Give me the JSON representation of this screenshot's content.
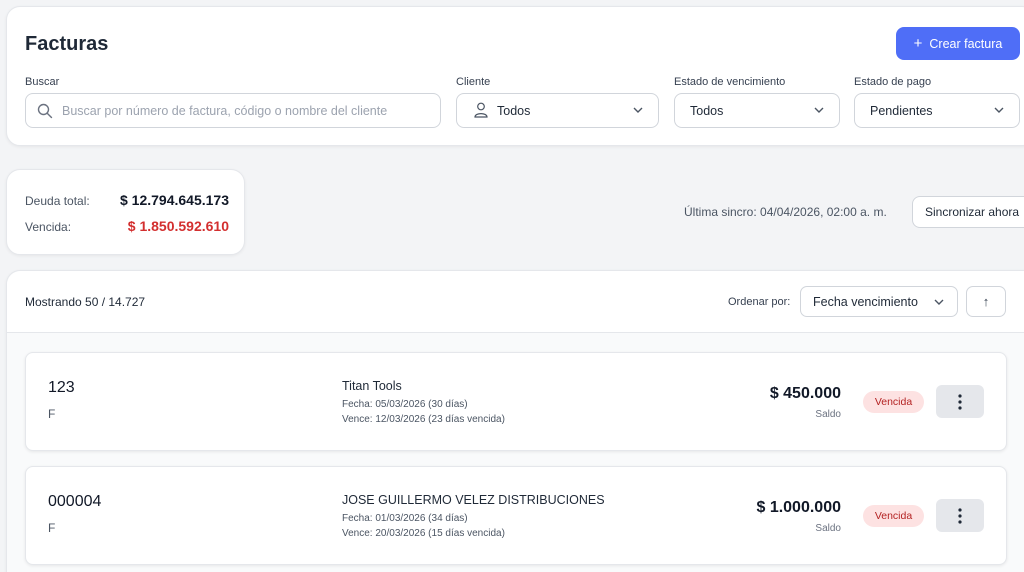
{
  "header": {
    "title": "Facturas",
    "create_button": "Crear factura",
    "create_button_icon": "plus-icon"
  },
  "filters": {
    "search": {
      "label": "Buscar",
      "placeholder": "Buscar por número de factura, código o nombre del cliente"
    },
    "client": {
      "label": "Cliente",
      "value": "Todos"
    },
    "due_status": {
      "label": "Estado de vencimiento",
      "value": "Todos"
    },
    "payment_status": {
      "label": "Estado de pago",
      "value": "Pendientes"
    }
  },
  "summary": {
    "total_label": "Deuda total:",
    "total_value": "$ 12.794.645.173",
    "overdue_label": "Vencida:",
    "overdue_value": "$ 1.850.592.610",
    "last_sync": "Última sincro: 04/04/2026, 02:00 a. m.",
    "sync_button": "Sincronizar ahora"
  },
  "list": {
    "showing": "Mostrando 50 / 14.727",
    "sort_label": "Ordenar por:",
    "sort_value": "Fecha vencimiento",
    "sort_direction": "↑",
    "invoices": [
      {
        "number": "123",
        "type": "F",
        "client": "Titan Tools",
        "date": "Fecha: 05/03/2026 (30 días)",
        "due": "Vence: 12/03/2026 (23 días vencida)",
        "amount": "$ 450.000",
        "amount_label": "Saldo",
        "status": "Vencida"
      },
      {
        "number": "000004",
        "type": "F",
        "client": "JOSE GUILLERMO VELEZ DISTRIBUCIONES",
        "date": "Fecha: 01/03/2026 (34 días)",
        "due": "Vence: 20/03/2026 (15 días vencida)",
        "amount": "$ 1.000.000",
        "amount_label": "Saldo",
        "status": "Vencida"
      }
    ]
  },
  "colors": {
    "primary": "#4f6ef7",
    "danger": "#d32f2f",
    "badge_bg": "#fde2e2",
    "badge_text": "#b42323"
  }
}
